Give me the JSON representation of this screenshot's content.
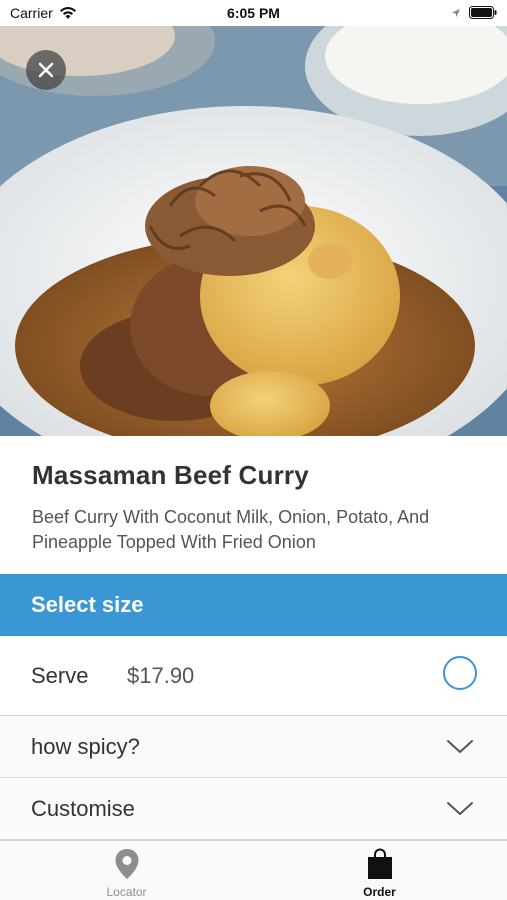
{
  "status_bar": {
    "carrier": "Carrier",
    "time": "6:05 PM",
    "wifi_icon": "wifi-icon",
    "location_icon": "location-arrow-icon",
    "battery_icon": "battery-icon"
  },
  "hero": {
    "image": "massaman-beef-curry-photo",
    "close_icon": "close-icon"
  },
  "dish": {
    "title": "Massaman Beef Curry",
    "description": "Beef Curry With Coconut Milk, Onion, Potato, And Pineapple Topped With Fried Onion"
  },
  "size_section": {
    "header": "Select size",
    "option": {
      "label": "Serve",
      "price": "$17.90",
      "selected": false
    }
  },
  "options": [
    {
      "label": "how spicy?",
      "icon": "chevron-down-icon"
    },
    {
      "label": "Customise",
      "icon": "chevron-down-icon"
    }
  ],
  "tab_bar": {
    "tabs": [
      {
        "label": "Locator",
        "icon": "map-pin-icon",
        "active": false
      },
      {
        "label": "Order",
        "icon": "shopping-bag-icon",
        "active": true
      }
    ]
  },
  "colors": {
    "accent": "#3b97d3",
    "active_tab": "#111111",
    "inactive_tab": "#8e8e8e"
  }
}
